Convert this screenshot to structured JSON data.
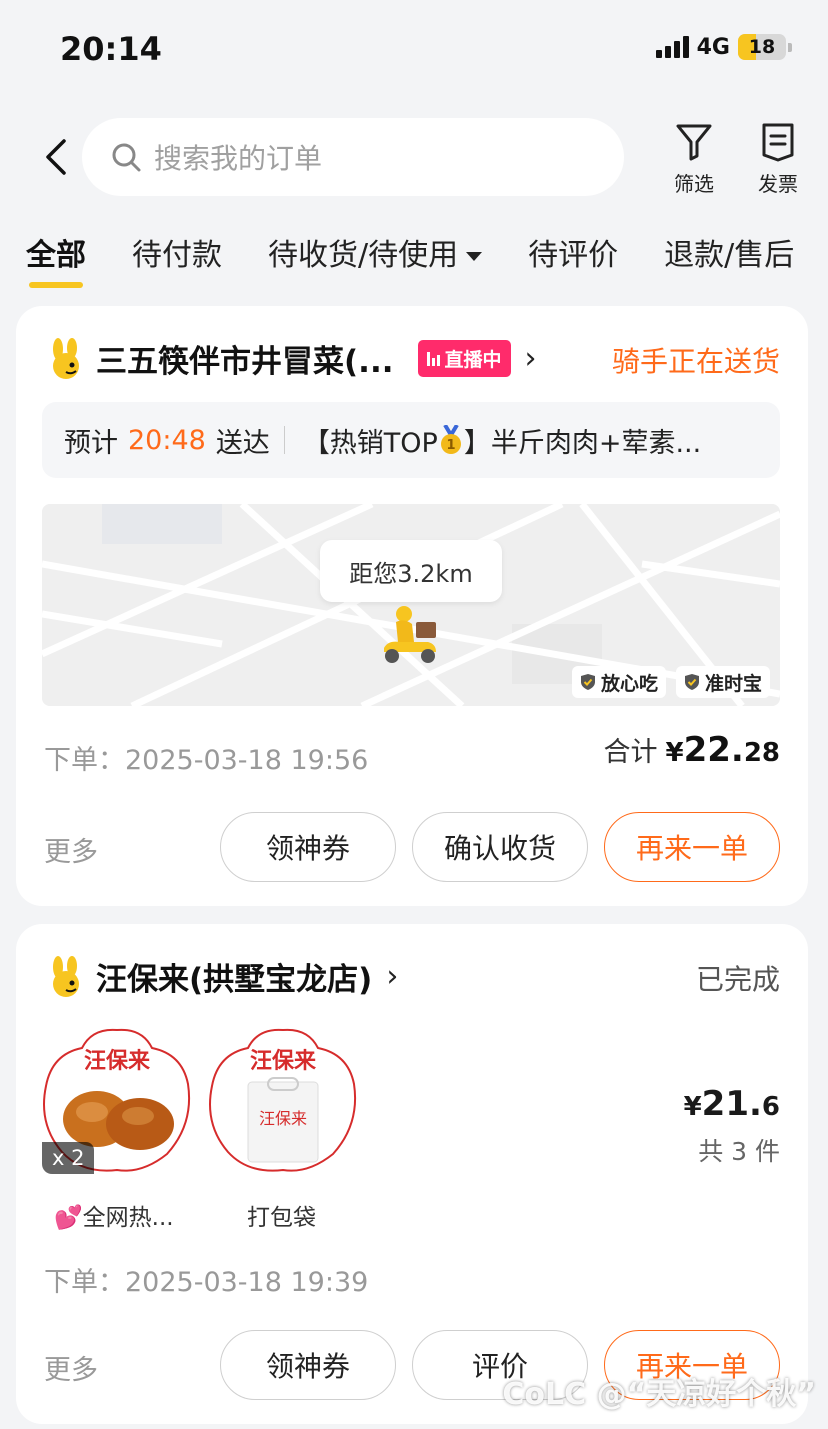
{
  "status_bar": {
    "time": "20:14",
    "network": "4G",
    "battery": "18"
  },
  "header": {
    "search_placeholder": "搜索我的订单",
    "filter_label": "筛选",
    "invoice_label": "发票"
  },
  "tabs": [
    {
      "label": "全部",
      "active": true
    },
    {
      "label": "待付款"
    },
    {
      "label": "待收货/待使用"
    },
    {
      "label": "待评价"
    },
    {
      "label": "退款/售后"
    }
  ],
  "orders": [
    {
      "shop_name": "三五筷伴市井冒菜(...",
      "live_badge": "直播中",
      "status": "骑手正在送货",
      "eta_prefix": "预计",
      "eta_time": "20:48",
      "eta_suffix": "送达",
      "item_summary_a": "【热销TOP",
      "item_summary_b": "】半斤肉肉+荤素...",
      "map": {
        "distance": "距您3.2km",
        "badge_1": "放心吃",
        "badge_2": "准时宝"
      },
      "order_time": "下单：2025-03-18 19:56",
      "total_label": "合计",
      "total_yen": "¥",
      "total_int": "22.",
      "total_dec": "28",
      "more": "更多",
      "buttons": [
        "领神券",
        "确认收货",
        "再来一单"
      ]
    },
    {
      "shop_name": "汪保来(拱墅宝龙店)",
      "status": "已完成",
      "products": [
        {
          "name": "💕全网热...",
          "qty": "x 2"
        },
        {
          "name": "打包袋"
        }
      ],
      "product_brand": "汪保来",
      "price_yen": "¥",
      "price_int": "21.",
      "price_dec": "6",
      "count": "共 3 件",
      "order_time": "下单：2025-03-18 19:39",
      "more": "更多",
      "buttons": [
        "领神券",
        "评价",
        "再来一单"
      ]
    }
  ],
  "watermark": "CoLC @“天凉好个秋”",
  "colors": {
    "accent_yellow": "#f7c520",
    "accent_orange": "#ff6a1a",
    "live_pink": "#ff2b6b"
  }
}
